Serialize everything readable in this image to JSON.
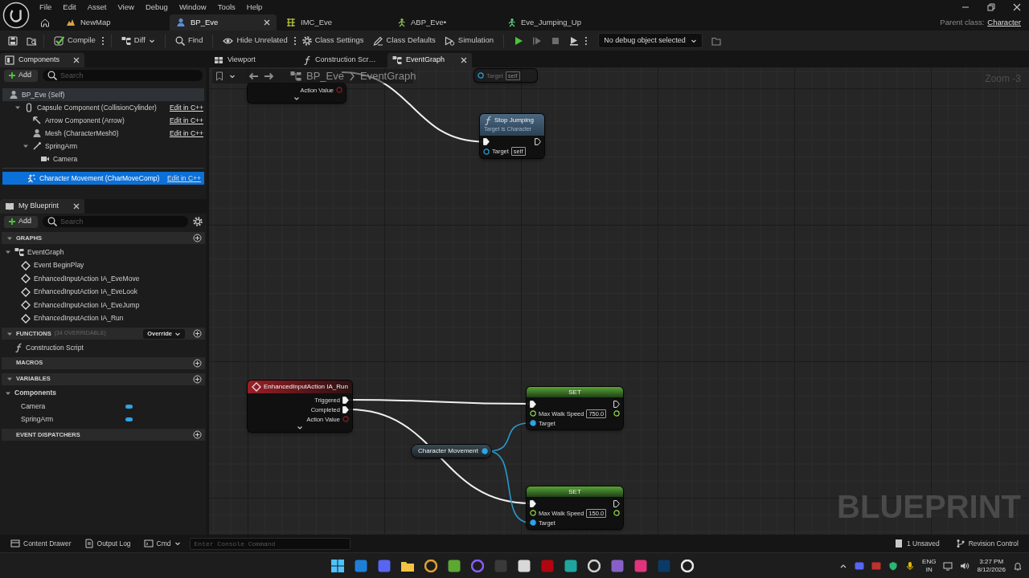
{
  "menu": [
    "File",
    "Edit",
    "Asset",
    "View",
    "Debug",
    "Window",
    "Tools",
    "Help"
  ],
  "document_tabs": [
    {
      "label": "NewMap",
      "kind": "level",
      "selected": false
    },
    {
      "label": "BP_Eve",
      "kind": "blueprint",
      "selected": true
    },
    {
      "label": "IMC_Eve",
      "kind": "input",
      "selected": false
    },
    {
      "label": "ABP_Eve•",
      "kind": "anim",
      "selected": false
    },
    {
      "label": "Eve_Jumping_Up",
      "kind": "anim-sequence",
      "selected": false
    }
  ],
  "parent_class": {
    "label": "Parent class:",
    "value": "Character"
  },
  "toolbar": [
    {
      "label": "Compile",
      "kind": "compile"
    },
    {
      "label": "Diff",
      "kind": "diff"
    },
    {
      "label": "Find",
      "kind": "find"
    },
    {
      "label": "Hide Unrelated",
      "kind": "hide-unrelated"
    },
    {
      "label": "Class Settings",
      "kind": "class-settings"
    },
    {
      "label": "Class Defaults",
      "kind": "class-defaults"
    },
    {
      "label": "Simulation",
      "kind": "simulation"
    }
  ],
  "play_controls": [
    {
      "kind": "play",
      "disabled": false
    },
    {
      "kind": "advance",
      "disabled": true
    },
    {
      "kind": "stop",
      "disabled": true
    },
    {
      "kind": "eject",
      "disabled": false
    }
  ],
  "debug_select": "No debug object selected",
  "components": {
    "title": "Components",
    "add": "Add",
    "search_placeholder": "Search",
    "tree": [
      {
        "label": "BP_Eve (Self)",
        "kind": "actor",
        "selected": false,
        "children": [
          {
            "label": "Capsule Component (CollisionCylinder)",
            "kind": "capsule",
            "link": "Edit in C++",
            "expanded": true,
            "selected": false,
            "children": [
              {
                "label": "Arrow Component (Arrow)",
                "kind": "arrow",
                "link": "Edit in C++",
                "selected": false
              },
              {
                "label": "Mesh (CharacterMesh0)",
                "kind": "mesh",
                "link": "Edit in C++",
                "selected": false
              },
              {
                "label": "SpringArm",
                "kind": "spring-arm",
                "expanded": true,
                "selected": false,
                "children": [
                  {
                    "label": "Camera",
                    "kind": "camera",
                    "selected": false
                  }
                ]
              }
            ]
          },
          {
            "label": "Character Movement (CharMoveComp)",
            "kind": "movement",
            "link": "Edit in C++",
            "selected": true
          }
        ]
      }
    ]
  },
  "my_blueprint": {
    "title": "My Blueprint",
    "add": "Add",
    "search_placeholder": "Search",
    "sections": [
      {
        "title": "GRAPHS",
        "expanded": true,
        "items": [
          {
            "label": "EventGraph",
            "kind": "graph",
            "expanded": true,
            "selected": false,
            "children": [
              {
                "label": "Event BeginPlay",
                "kind": "event",
                "selected": false
              },
              {
                "label": "EnhancedInputAction IA_EveMove",
                "kind": "event",
                "selected": false
              },
              {
                "label": "EnhancedInputAction IA_EveLook",
                "kind": "event",
                "selected": false
              },
              {
                "label": "EnhancedInputAction IA_EveJump",
                "kind": "event",
                "selected": false
              },
              {
                "label": "EnhancedInputAction IA_Run",
                "kind": "event",
                "selected": false
              }
            ]
          }
        ]
      },
      {
        "title": "FUNCTIONS",
        "note": "(34 OVERRIDABLE)",
        "dropdown": "Override",
        "expanded": true,
        "items": [
          {
            "label": "Construction Script",
            "kind": "function",
            "selected": false
          }
        ]
      },
      {
        "title": "MACROS"
      },
      {
        "title": "VARIABLES",
        "expanded": true,
        "items": [
          {
            "label": "Components",
            "kind": "category",
            "expanded": true,
            "selected": false,
            "children": [
              {
                "label": "Camera",
                "kind": "variable",
                "selected": false
              },
              {
                "label": "SpringArm",
                "kind": "variable",
                "selected": false
              }
            ]
          }
        ]
      },
      {
        "title": "EVENT DISPATCHERS"
      }
    ]
  },
  "graph_tabs": [
    {
      "label": "Viewport",
      "kind": "viewport",
      "selected": false
    },
    {
      "label": "Construction Scr…",
      "kind": "function",
      "selected": false
    },
    {
      "label": "EventGraph",
      "kind": "graph",
      "selected": true
    }
  ],
  "breadcrumb": [
    "BP_Eve",
    "EventGraph"
  ],
  "zoom": "Zoom -3",
  "nodes": [
    {
      "kind": "event-fragment",
      "outputs": [
        {
          "kind": "struct",
          "label": "Action Value",
          "connected": false
        }
      ]
    },
    {
      "kind": "call-fragment",
      "inputs": [
        {
          "kind": "object",
          "label": "Target",
          "value": "self",
          "connected": false
        }
      ]
    },
    {
      "kind": "function",
      "title": "Stop Jumping",
      "subtitle": "Target is Character",
      "inputs": [
        {
          "kind": "exec",
          "connected": true
        },
        {
          "kind": "object",
          "label": "Target",
          "value": "self",
          "connected": false
        }
      ],
      "outputs": [
        {
          "kind": "exec",
          "connected": false
        }
      ]
    },
    {
      "kind": "event",
      "title": "EnhancedInputAction IA_Run",
      "outputs": [
        {
          "kind": "exec",
          "label": "Triggered",
          "connected": true
        },
        {
          "kind": "exec",
          "label": "Completed",
          "connected": true
        },
        {
          "kind": "struct",
          "label": "Action Value",
          "connected": false
        }
      ]
    },
    {
      "kind": "variable",
      "title": "Character Movement",
      "outputs": [
        {
          "kind": "object",
          "connected": true
        }
      ]
    },
    {
      "kind": "set",
      "title": "SET",
      "inputs": [
        {
          "kind": "exec",
          "connected": true
        },
        {
          "kind": "float",
          "label": "Max Walk Speed",
          "value": "750.0",
          "connected": false
        },
        {
          "kind": "object",
          "label": "Target",
          "connected": true
        }
      ],
      "outputs": [
        {
          "kind": "exec",
          "connected": false
        },
        {
          "kind": "float",
          "connected": false
        }
      ]
    },
    {
      "kind": "set",
      "title": "SET",
      "inputs": [
        {
          "kind": "exec",
          "connected": true
        },
        {
          "kind": "float",
          "label": "Max Walk Speed",
          "value": "150.0",
          "connected": false
        },
        {
          "kind": "object",
          "label": "Target",
          "connected": true
        }
      ],
      "outputs": [
        {
          "kind": "exec",
          "connected": false
        },
        {
          "kind": "float",
          "connected": false
        }
      ]
    }
  ],
  "graph_label": "BLUEPRINT",
  "status_bar": {
    "items": [
      {
        "label": "Content Drawer",
        "kind": "drawer"
      },
      {
        "label": "Output Log",
        "kind": "log"
      },
      {
        "label": "Cmd",
        "kind": "cmd"
      }
    ],
    "console_placeholder": "Enter Console Command",
    "unsaved": "1 Unsaved",
    "revision_control": "Revision Control"
  },
  "taskbar": {
    "language": {
      "primary": "ENG",
      "secondary": "IN"
    },
    "time": "3:27 PM",
    "date": "8/12/2026"
  }
}
